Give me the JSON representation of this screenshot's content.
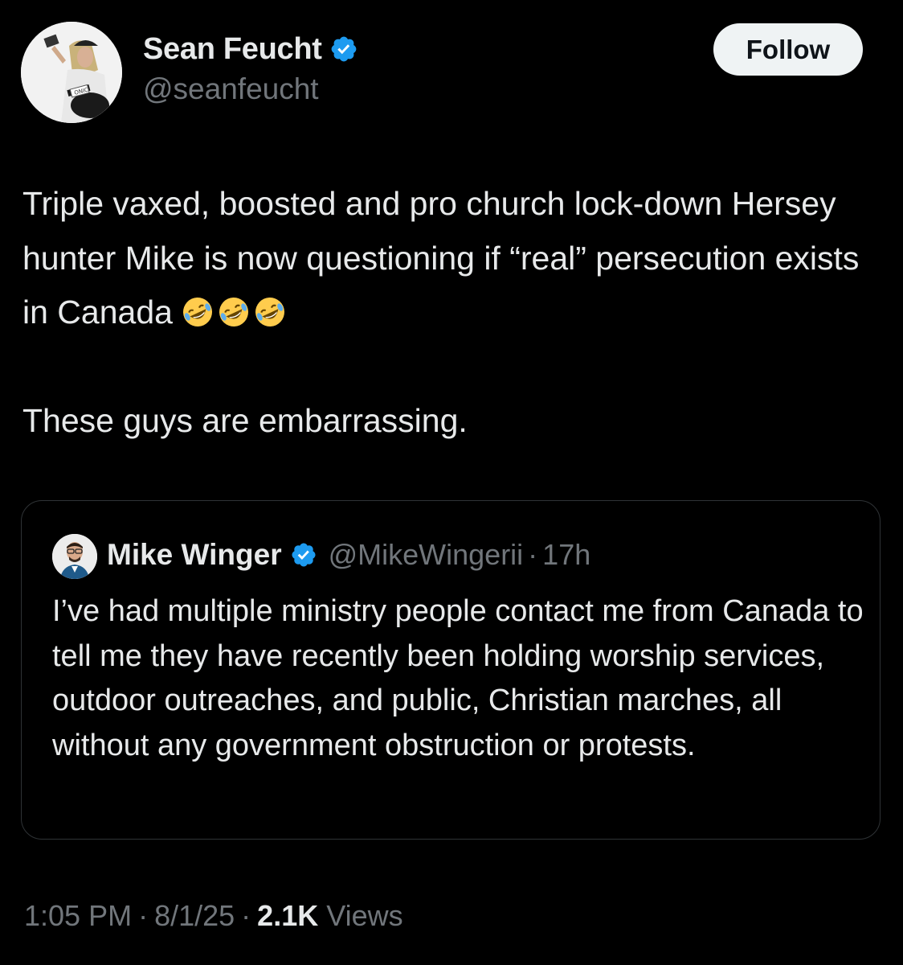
{
  "author": {
    "display_name": "Sean Feucht",
    "handle": "@seanfeucht",
    "avatar_icon": "profile-photo-avatar",
    "verified": true,
    "verified_color": "#1d9bf0"
  },
  "follow_button": {
    "label": "Follow"
  },
  "tweet": {
    "line1": "Triple vaxed, boosted and pro church lock-down Hersey hunter Mike is now questioning if “real” persecution exists in Canada",
    "emojis": [
      "rolling-on-floor-laughing-emoji",
      "rolling-on-floor-laughing-emoji",
      "rolling-on-floor-laughing-emoji"
    ],
    "line2": "These guys are embarrassing."
  },
  "quoted_tweet": {
    "display_name": "Mike Winger",
    "handle": "@MikeWingerii",
    "separator": "·",
    "time": "17h",
    "verified": true,
    "text": "I’ve had multiple ministry people contact me from Canada to tell me they have recently been holding worship services, outdoor outreaches, and public, Christian marches, all without any government obstruction or protests."
  },
  "meta": {
    "time": "1:05 PM",
    "separator": "·",
    "date": "8/1/25",
    "views_count": "2.1K",
    "views_label": "Views"
  },
  "colors": {
    "background": "#000000",
    "text_primary": "#e7e9ea",
    "text_secondary": "#71767b",
    "border": "#2f3336",
    "accent": "#1d9bf0"
  }
}
